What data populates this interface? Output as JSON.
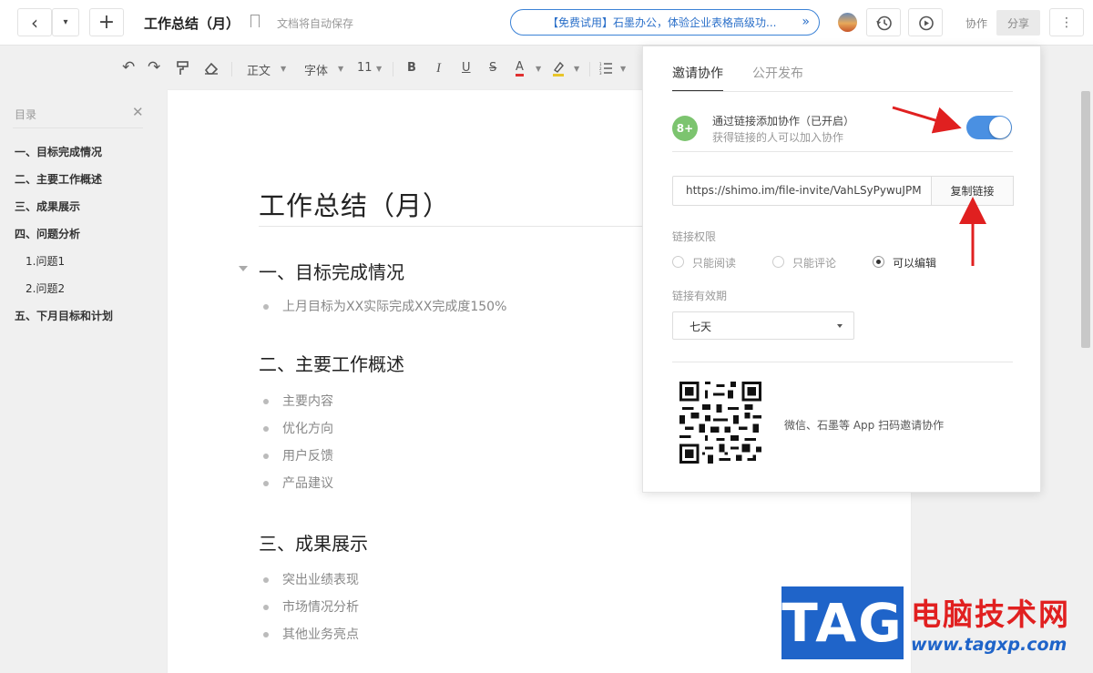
{
  "topbar": {
    "doc_title": "工作总结（月）",
    "autosave": "文档将自动保存",
    "promo": "【免费试用】石墨办公，体验企业表格高级功...",
    "promo_arrow": "»",
    "collab_label": "协作",
    "share_label": "分享",
    "more_label": "⋮",
    "back_label": "‹",
    "dropdown_label": "▾",
    "new_label": "+"
  },
  "toolbar": {
    "undo": "↶",
    "redo": "↷",
    "paragraph_style": "正文",
    "font": "字体",
    "font_size": "11",
    "bold": "B",
    "italic": "I",
    "underline": "U",
    "strike": "S",
    "color": "A"
  },
  "sidebar": {
    "title": "目录",
    "close": "✕",
    "items": [
      {
        "label": "一、目标完成情况"
      },
      {
        "label": "二、主要工作概述"
      },
      {
        "label": "三、成果展示"
      },
      {
        "label": "四、问题分析"
      },
      {
        "label": "1.问题1"
      },
      {
        "label": "2.问题2"
      },
      {
        "label": "五、下月目标和计划"
      }
    ]
  },
  "document": {
    "title": "工作总结（月）",
    "sections": [
      {
        "heading": "一、目标完成情况",
        "bullets": [
          "上月目标为XX实际完成XX完成度150%"
        ]
      },
      {
        "heading": "二、主要工作概述",
        "bullets": [
          "主要内容",
          "优化方向",
          "用户反馈",
          "产品建议"
        ]
      },
      {
        "heading": "三、成果展示",
        "bullets": [
          "突出业绩表现",
          "市场情况分析",
          "其他业务亮点"
        ]
      }
    ]
  },
  "share_panel": {
    "tabs": [
      {
        "label": "邀请协作"
      },
      {
        "label": "公开发布"
      }
    ],
    "link_invite_title": "通过链接添加协作（已开启）",
    "link_invite_sub": "获得链接的人可以加入协作",
    "link_invite_on": true,
    "invite_url": "https://shimo.im/file-invite/VahLSyPywuJPM",
    "copy_button": "复制链接",
    "permission_label": "链接权限",
    "permissions": [
      {
        "label": "只能阅读",
        "selected": false
      },
      {
        "label": "只能评论",
        "selected": false
      },
      {
        "label": "可以编辑",
        "selected": true
      }
    ],
    "expiry_label": "链接有效期",
    "expiry_value": "七天",
    "qr_text": "微信、石墨等 App 扫码邀请协作"
  },
  "watermark": {
    "tag": "TAG",
    "site_name": "电脑技术网",
    "site_url": "www.tagxp.com"
  },
  "colors": {
    "accent_blue": "#4a90e2",
    "annotation_red": "#e02020",
    "invite_green": "#7cc46f"
  }
}
